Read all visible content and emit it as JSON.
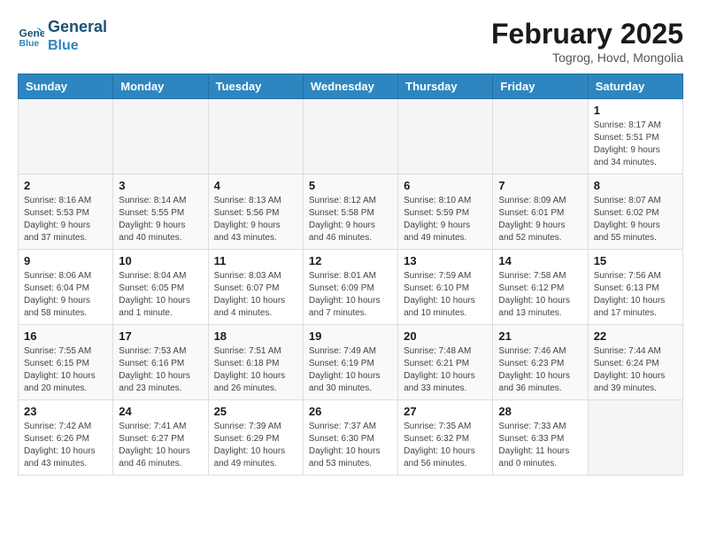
{
  "header": {
    "logo_line1": "General",
    "logo_line2": "Blue",
    "month_year": "February 2025",
    "location": "Togrog, Hovd, Mongolia"
  },
  "weekdays": [
    "Sunday",
    "Monday",
    "Tuesday",
    "Wednesday",
    "Thursday",
    "Friday",
    "Saturday"
  ],
  "weeks": [
    [
      {
        "day": "",
        "info": ""
      },
      {
        "day": "",
        "info": ""
      },
      {
        "day": "",
        "info": ""
      },
      {
        "day": "",
        "info": ""
      },
      {
        "day": "",
        "info": ""
      },
      {
        "day": "",
        "info": ""
      },
      {
        "day": "1",
        "info": "Sunrise: 8:17 AM\nSunset: 5:51 PM\nDaylight: 9 hours and 34 minutes."
      }
    ],
    [
      {
        "day": "2",
        "info": "Sunrise: 8:16 AM\nSunset: 5:53 PM\nDaylight: 9 hours and 37 minutes."
      },
      {
        "day": "3",
        "info": "Sunrise: 8:14 AM\nSunset: 5:55 PM\nDaylight: 9 hours and 40 minutes."
      },
      {
        "day": "4",
        "info": "Sunrise: 8:13 AM\nSunset: 5:56 PM\nDaylight: 9 hours and 43 minutes."
      },
      {
        "day": "5",
        "info": "Sunrise: 8:12 AM\nSunset: 5:58 PM\nDaylight: 9 hours and 46 minutes."
      },
      {
        "day": "6",
        "info": "Sunrise: 8:10 AM\nSunset: 5:59 PM\nDaylight: 9 hours and 49 minutes."
      },
      {
        "day": "7",
        "info": "Sunrise: 8:09 AM\nSunset: 6:01 PM\nDaylight: 9 hours and 52 minutes."
      },
      {
        "day": "8",
        "info": "Sunrise: 8:07 AM\nSunset: 6:02 PM\nDaylight: 9 hours and 55 minutes."
      }
    ],
    [
      {
        "day": "9",
        "info": "Sunrise: 8:06 AM\nSunset: 6:04 PM\nDaylight: 9 hours and 58 minutes."
      },
      {
        "day": "10",
        "info": "Sunrise: 8:04 AM\nSunset: 6:05 PM\nDaylight: 10 hours and 1 minute."
      },
      {
        "day": "11",
        "info": "Sunrise: 8:03 AM\nSunset: 6:07 PM\nDaylight: 10 hours and 4 minutes."
      },
      {
        "day": "12",
        "info": "Sunrise: 8:01 AM\nSunset: 6:09 PM\nDaylight: 10 hours and 7 minutes."
      },
      {
        "day": "13",
        "info": "Sunrise: 7:59 AM\nSunset: 6:10 PM\nDaylight: 10 hours and 10 minutes."
      },
      {
        "day": "14",
        "info": "Sunrise: 7:58 AM\nSunset: 6:12 PM\nDaylight: 10 hours and 13 minutes."
      },
      {
        "day": "15",
        "info": "Sunrise: 7:56 AM\nSunset: 6:13 PM\nDaylight: 10 hours and 17 minutes."
      }
    ],
    [
      {
        "day": "16",
        "info": "Sunrise: 7:55 AM\nSunset: 6:15 PM\nDaylight: 10 hours and 20 minutes."
      },
      {
        "day": "17",
        "info": "Sunrise: 7:53 AM\nSunset: 6:16 PM\nDaylight: 10 hours and 23 minutes."
      },
      {
        "day": "18",
        "info": "Sunrise: 7:51 AM\nSunset: 6:18 PM\nDaylight: 10 hours and 26 minutes."
      },
      {
        "day": "19",
        "info": "Sunrise: 7:49 AM\nSunset: 6:19 PM\nDaylight: 10 hours and 30 minutes."
      },
      {
        "day": "20",
        "info": "Sunrise: 7:48 AM\nSunset: 6:21 PM\nDaylight: 10 hours and 33 minutes."
      },
      {
        "day": "21",
        "info": "Sunrise: 7:46 AM\nSunset: 6:23 PM\nDaylight: 10 hours and 36 minutes."
      },
      {
        "day": "22",
        "info": "Sunrise: 7:44 AM\nSunset: 6:24 PM\nDaylight: 10 hours and 39 minutes."
      }
    ],
    [
      {
        "day": "23",
        "info": "Sunrise: 7:42 AM\nSunset: 6:26 PM\nDaylight: 10 hours and 43 minutes."
      },
      {
        "day": "24",
        "info": "Sunrise: 7:41 AM\nSunset: 6:27 PM\nDaylight: 10 hours and 46 minutes."
      },
      {
        "day": "25",
        "info": "Sunrise: 7:39 AM\nSunset: 6:29 PM\nDaylight: 10 hours and 49 minutes."
      },
      {
        "day": "26",
        "info": "Sunrise: 7:37 AM\nSunset: 6:30 PM\nDaylight: 10 hours and 53 minutes."
      },
      {
        "day": "27",
        "info": "Sunrise: 7:35 AM\nSunset: 6:32 PM\nDaylight: 10 hours and 56 minutes."
      },
      {
        "day": "28",
        "info": "Sunrise: 7:33 AM\nSunset: 6:33 PM\nDaylight: 11 hours and 0 minutes."
      },
      {
        "day": "",
        "info": ""
      }
    ]
  ]
}
